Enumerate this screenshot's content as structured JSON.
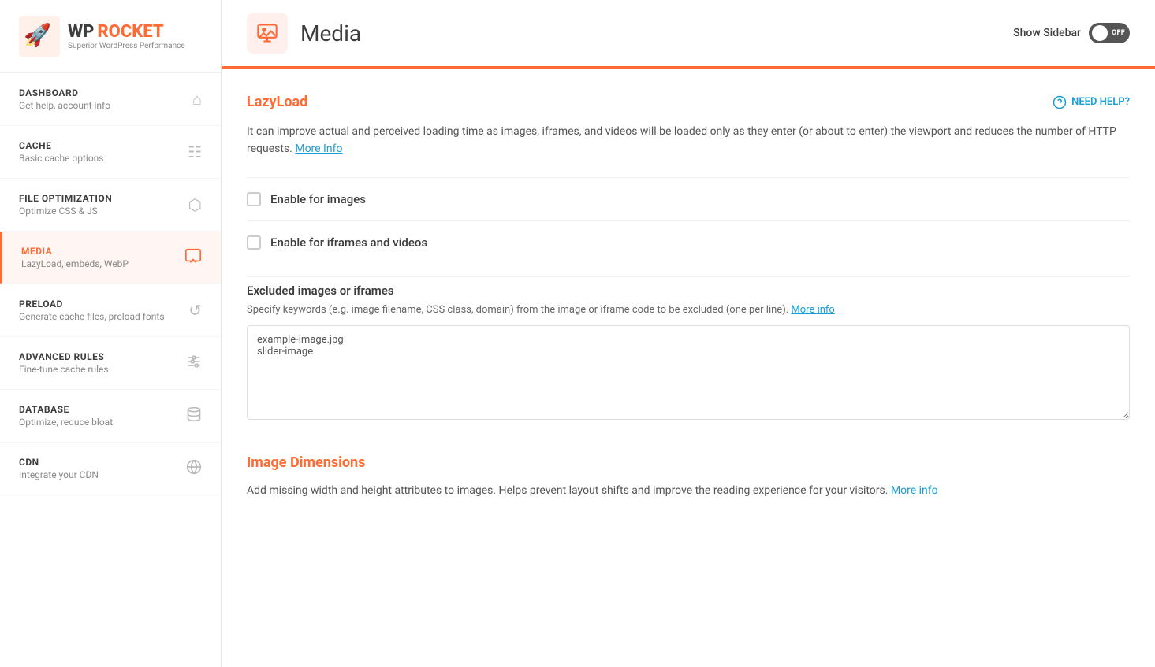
{
  "logo": {
    "text_wp": "WP",
    "text_rocket": "ROCKET",
    "subtitle": "Superior WordPress Performance"
  },
  "nav": {
    "items": [
      {
        "id": "dashboard",
        "title": "DASHBOARD",
        "subtitle": "Get help, account info",
        "icon": "🏠",
        "active": false
      },
      {
        "id": "cache",
        "title": "CACHE",
        "subtitle": "Basic cache options",
        "icon": "📄",
        "active": false
      },
      {
        "id": "file-optimization",
        "title": "FILE OPTIMIZATION",
        "subtitle": "Optimize CSS & JS",
        "icon": "⬡",
        "active": false
      },
      {
        "id": "media",
        "title": "MEDIA",
        "subtitle": "LazyLoad, embeds, WebP",
        "icon": "🖼",
        "active": true
      },
      {
        "id": "preload",
        "title": "PRELOAD",
        "subtitle": "Generate cache files, preload fonts",
        "icon": "↺",
        "active": false
      },
      {
        "id": "advanced-rules",
        "title": "ADVANCED RULES",
        "subtitle": "Fine-tune cache rules",
        "icon": "☰",
        "active": false
      },
      {
        "id": "database",
        "title": "DATABASE",
        "subtitle": "Optimize, reduce bloat",
        "icon": "🗄",
        "active": false
      },
      {
        "id": "cdn",
        "title": "CDN",
        "subtitle": "Integrate your CDN",
        "icon": "🌐",
        "active": false
      }
    ]
  },
  "header": {
    "page_title": "Media",
    "sidebar_toggle_label": "Show Sidebar",
    "toggle_state": "OFF"
  },
  "lazyload": {
    "section_title": "LazyLoad",
    "need_help_label": "NEED HELP?",
    "description": "It can improve actual and perceived loading time as images, iframes, and videos will be loaded only as they enter (or about to enter) the viewport and reduces the number of HTTP requests.",
    "more_info_link": "More Info",
    "options": [
      {
        "id": "enable-images",
        "label": "Enable for images",
        "checked": false
      },
      {
        "id": "enable-iframes",
        "label": "Enable for iframes and videos",
        "checked": false
      }
    ],
    "excluded": {
      "title": "Excluded images or iframes",
      "description": "Specify keywords (e.g. image filename, CSS class, domain) from the image or iframe code to be excluded (one per line).",
      "more_info_link": "More info",
      "textarea_value": "example-image.jpg\nslider-image",
      "textarea_placeholder": ""
    }
  },
  "image_dimensions": {
    "section_title": "Image Dimensions",
    "description": "Add missing width and height attributes to images. Helps prevent layout shifts and improve the reading experience for your visitors.",
    "more_info_link": "More info"
  }
}
